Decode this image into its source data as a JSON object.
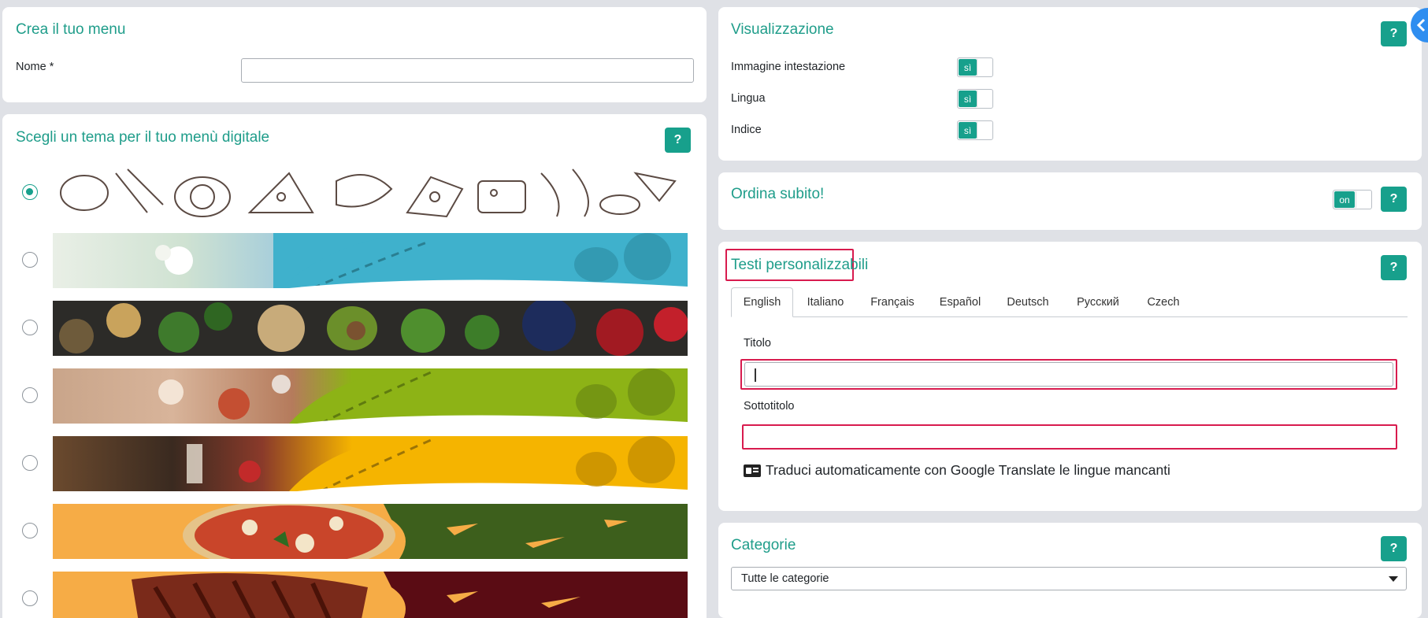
{
  "create_menu": {
    "title": "Crea il tuo menu",
    "name_label": "Nome",
    "required_mark": "*",
    "name_value": ""
  },
  "theme": {
    "title": "Scegli un tema per il tuo menù digitale",
    "help": "?",
    "selected_index": 0,
    "options": [
      "sketch-food",
      "flowers-blue",
      "vegetables-dark",
      "table-green",
      "glasses-yellow",
      "pizza-orange-green",
      "steak-orange-maroon"
    ]
  },
  "display": {
    "title": "Visualizzazione",
    "help": "?",
    "items": [
      {
        "label": "Immagine intestazione",
        "toggle": "sì"
      },
      {
        "label": "Lingua",
        "toggle": "sì"
      },
      {
        "label": "Indice",
        "toggle": "sì"
      }
    ]
  },
  "order": {
    "title": "Ordina subito!",
    "toggle": "on",
    "help": "?"
  },
  "texts": {
    "title": "Testi personalizzabili",
    "help": "?",
    "tabs": [
      "English",
      "Italiano",
      "Français",
      "Español",
      "Deutsch",
      "Русский",
      "Czech"
    ],
    "active_tab": "English",
    "title_label": "Titolo",
    "title_value": "",
    "subtitle_label": "Sottotitolo",
    "subtitle_value": "",
    "translate_text": "Traduci automaticamente con Google Translate le lingue mancanti"
  },
  "categories": {
    "title": "Categorie",
    "help": "?",
    "selected": "Tutte le categorie"
  },
  "colors": {
    "accent": "#17a08c",
    "highlight": "#d81b4e",
    "background": "#dfe1e6"
  }
}
